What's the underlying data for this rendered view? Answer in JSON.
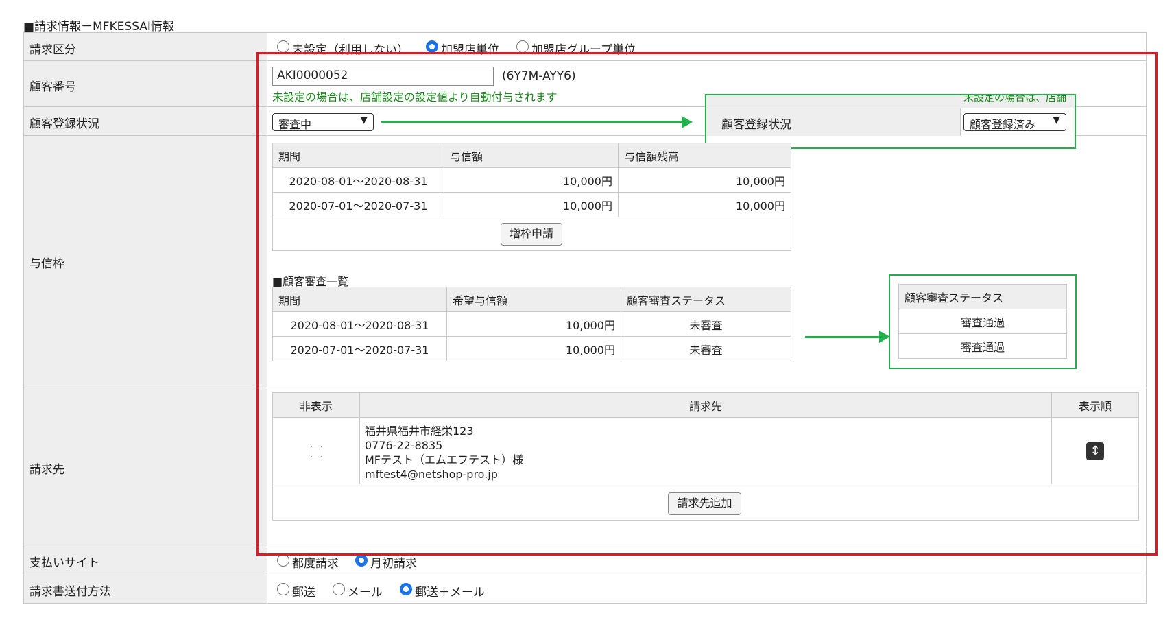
{
  "section_title": "■請求情報－MFKESSAI情報",
  "rows": {
    "billing_type": {
      "label": "請求区分",
      "options": [
        {
          "text": "未設定（利用しない）",
          "selected": false
        },
        {
          "text": "加盟店単位",
          "selected": true
        },
        {
          "text": "加盟店グループ単位",
          "selected": false
        }
      ]
    },
    "customer_number": {
      "label": "顧客番号",
      "value": "AKI0000052",
      "code": "(6Y7M-AYY6)",
      "note": "未設定の場合は、店舗設定の設定値より自動付与されます"
    },
    "registration_status": {
      "label": "顧客登録状況",
      "value": "審査中"
    },
    "credit_limit": {
      "label": "与信枠",
      "columns": [
        "期間",
        "与信額",
        "与信額残高"
      ],
      "rows": [
        [
          "2020-08-01～2020-08-31",
          "10,000円",
          "10,000円"
        ],
        [
          "2020-07-01～2020-07-31",
          "10,000円",
          "10,000円"
        ]
      ],
      "increase_button": "増枠申請",
      "review_title": "■顧客審査一覧",
      "review_columns": [
        "期間",
        "希望与信額",
        "顧客審査ステータス"
      ],
      "review_rows": [
        [
          "2020-08-01～2020-08-31",
          "10,000円",
          "未審査"
        ],
        [
          "2020-07-01～2020-07-31",
          "10,000円",
          "未審査"
        ]
      ]
    },
    "billing_address": {
      "label": "請求先",
      "columns": [
        "非表示",
        "請求先",
        "表示順"
      ],
      "address_lines": [
        "福井県福井市経栄123",
        "0776-22-8835",
        "MFテスト（エムエフテスト）様",
        "mftest4@netshop-pro.jp"
      ],
      "add_button": "請求先追加"
    },
    "payment_site": {
      "label": "支払いサイト",
      "options": [
        {
          "text": "都度請求",
          "selected": false
        },
        {
          "text": "月初請求",
          "selected": true
        }
      ]
    },
    "invoice_method": {
      "label": "請求書送付方法",
      "options": [
        {
          "text": "郵送",
          "selected": false
        },
        {
          "text": "メール",
          "selected": false
        },
        {
          "text": "郵送＋メール",
          "selected": true
        }
      ]
    }
  },
  "callouts": {
    "status_after": {
      "top_fragment": "未設定の場合は、店舗",
      "label": "顧客登録状況",
      "value": "顧客登録済み"
    },
    "review_after": {
      "header": "顧客審査ステータス",
      "rows": [
        "審査通過",
        "審査通過"
      ]
    }
  },
  "colors": {
    "highlight_red": "#e01a22",
    "highlight_green": "#22b04a",
    "note_green": "#1a8a1a",
    "radio_blue": "#1a73e8"
  },
  "icons": [
    "sort-vertical-icon",
    "arrow-right-icon",
    "chevron-down-icon"
  ]
}
